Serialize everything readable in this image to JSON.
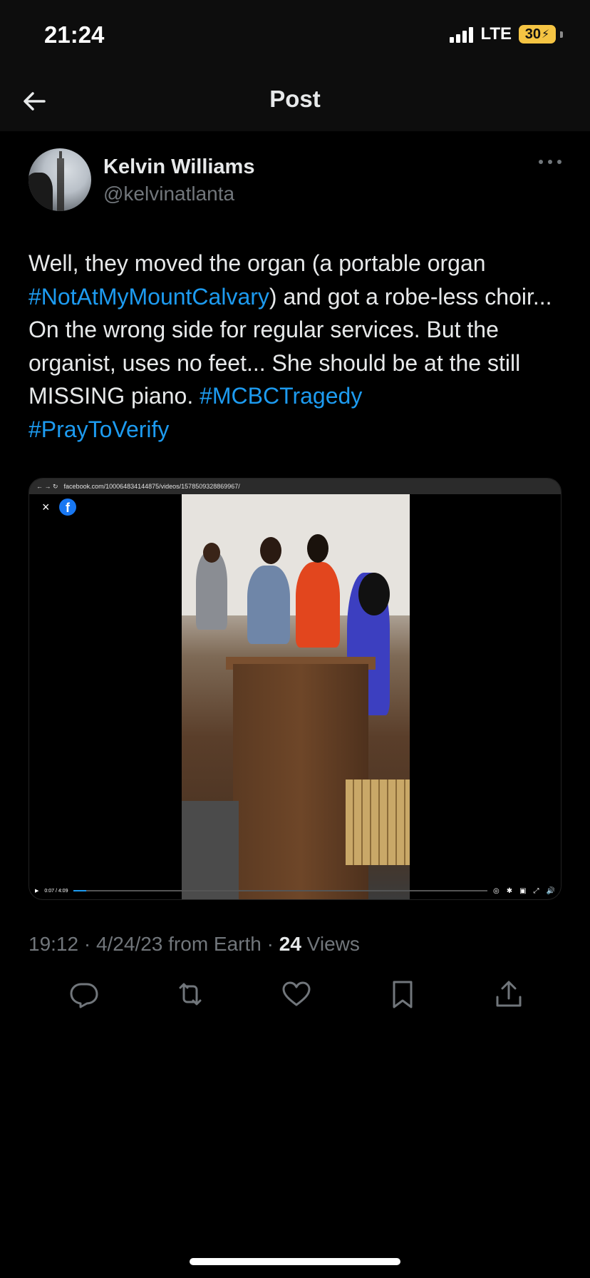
{
  "status_bar": {
    "time": "21:24",
    "network": "LTE",
    "battery": "30"
  },
  "nav": {
    "title": "Post",
    "back_icon": "arrow-left-icon"
  },
  "post": {
    "author_name": "Kelvin Williams",
    "author_handle": "@kelvinatlanta",
    "text_segments": [
      {
        "type": "text",
        "value": "Well, they moved the organ (a portable organ "
      },
      {
        "type": "hashtag",
        "value": "#NotAtMyMountCalvary"
      },
      {
        "type": "text",
        "value": ") and got a robe-less choir...  On the wrong side for regular services.  But the organist, uses no feet...  She should be at the still MISSING piano.  "
      },
      {
        "type": "hashtag",
        "value": "#MCBCTragedy"
      },
      {
        "type": "text",
        "value": " "
      },
      {
        "type": "hashtag",
        "value": "#PrayToVerify"
      }
    ],
    "media": {
      "browser_url": "facebook.com/100064834144875/videos/1578509328869967/",
      "video_time": "0:07 / 4:09",
      "video_progress": 0.03
    },
    "timestamp": "19:12 · 4/24/23 from Earth · ",
    "views_count": "24",
    "views_label": " Views"
  },
  "actions": [
    {
      "name": "reply-icon"
    },
    {
      "name": "repost-icon"
    },
    {
      "name": "like-icon"
    },
    {
      "name": "bookmark-icon"
    },
    {
      "name": "share-icon"
    }
  ],
  "colors": {
    "accent": "#1d9bf0",
    "secondary_text": "#71767b",
    "primary_text": "#e7e9ea"
  }
}
